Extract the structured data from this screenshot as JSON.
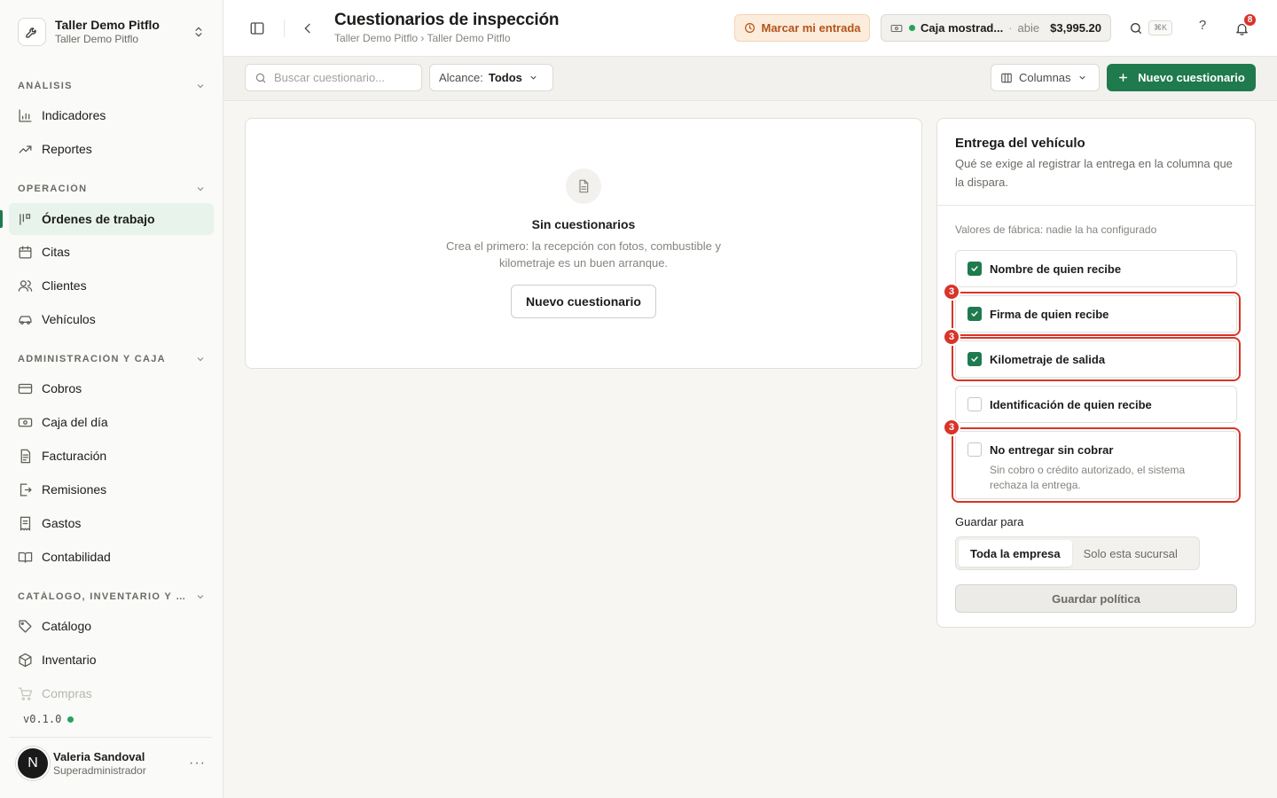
{
  "org": {
    "name": "Taller Demo Pitflo",
    "subtitle": "Taller Demo Pitflo"
  },
  "sidebar": {
    "sections": [
      {
        "title": "ANÁLISIS",
        "items": [
          {
            "label": "Indicadores",
            "icon": "chart-bar-icon"
          },
          {
            "label": "Reportes",
            "icon": "trend-icon"
          }
        ]
      },
      {
        "title": "OPERACIÓN",
        "items": [
          {
            "label": "Órdenes de trabajo",
            "icon": "kanban-icon",
            "active": true
          },
          {
            "label": "Citas",
            "icon": "calendar-icon"
          },
          {
            "label": "Clientes",
            "icon": "users-icon"
          },
          {
            "label": "Vehículos",
            "icon": "car-icon"
          }
        ]
      },
      {
        "title": "ADMINISTRACIÓN Y CAJA",
        "items": [
          {
            "label": "Cobros",
            "icon": "credit-card-icon"
          },
          {
            "label": "Caja del día",
            "icon": "cash-icon"
          },
          {
            "label": "Facturación",
            "icon": "invoice-icon"
          },
          {
            "label": "Remisiones",
            "icon": "file-export-icon"
          },
          {
            "label": "Gastos",
            "icon": "receipt-icon"
          },
          {
            "label": "Contabilidad",
            "icon": "book-icon"
          }
        ]
      },
      {
        "title": "CATÁLOGO, INVENTARIO Y CO...",
        "items": [
          {
            "label": "Catálogo",
            "icon": "tag-icon"
          },
          {
            "label": "Inventario",
            "icon": "box-icon"
          },
          {
            "label": "Compras",
            "icon": "cart-icon"
          }
        ]
      }
    ],
    "version": "v0.1.0"
  },
  "user": {
    "initial": "N",
    "name": "Valeria Sandoval",
    "role": "Superadministrador",
    "more": "···"
  },
  "header": {
    "title": "Cuestionarios de inspección",
    "breadcrumb": "Taller Demo Pitflo › Taller Demo Pitflo",
    "entry_label": "Marcar mi entrada",
    "cash_name": "Caja mostrad...",
    "cash_sep": "·",
    "cash_status": "abie",
    "cash_amount": "$3,995.20",
    "kbd": "⌘K",
    "help": "?",
    "notif_count": "8"
  },
  "toolbar": {
    "search_placeholder": "Buscar cuestionario...",
    "scope_label": "Alcance:",
    "scope_value": "Todos",
    "columns_label": "Columnas",
    "new_label": "Nuevo cuestionario"
  },
  "empty": {
    "title": "Sin cuestionarios",
    "desc": "Crea el primero: la recepción con fotos, combustible y kilometraje es un buen arranque.",
    "button": "Nuevo cuestionario"
  },
  "panel": {
    "title": "Entrega del vehículo",
    "desc": "Qué se exige al registrar la entrega en la columna que la dispara.",
    "defaults_note": "Valores de fábrica: nadie la ha configurado",
    "options": [
      {
        "label": "Nombre de quien recibe",
        "checked": true,
        "mark": ""
      },
      {
        "label": "Firma de quien recibe",
        "checked": true,
        "mark": "3"
      },
      {
        "label": "Kilometraje de salida",
        "checked": true,
        "mark": "3"
      },
      {
        "label": "Identificación de quien recibe",
        "checked": false,
        "mark": ""
      },
      {
        "label": "No entregar sin cobrar",
        "checked": false,
        "mark": "3",
        "sub": "Sin cobro o crédito autorizado, el sistema rechaza la entrega."
      }
    ],
    "save_for_label": "Guardar para",
    "scope_options": [
      "Toda la empresa",
      "Solo esta sucursal"
    ],
    "save_button": "Guardar política"
  },
  "colors": {
    "accent": "#1f7a4d",
    "danger": "#d8342a",
    "warning_bg": "#fcecdc",
    "warning_text": "#b3541a"
  }
}
